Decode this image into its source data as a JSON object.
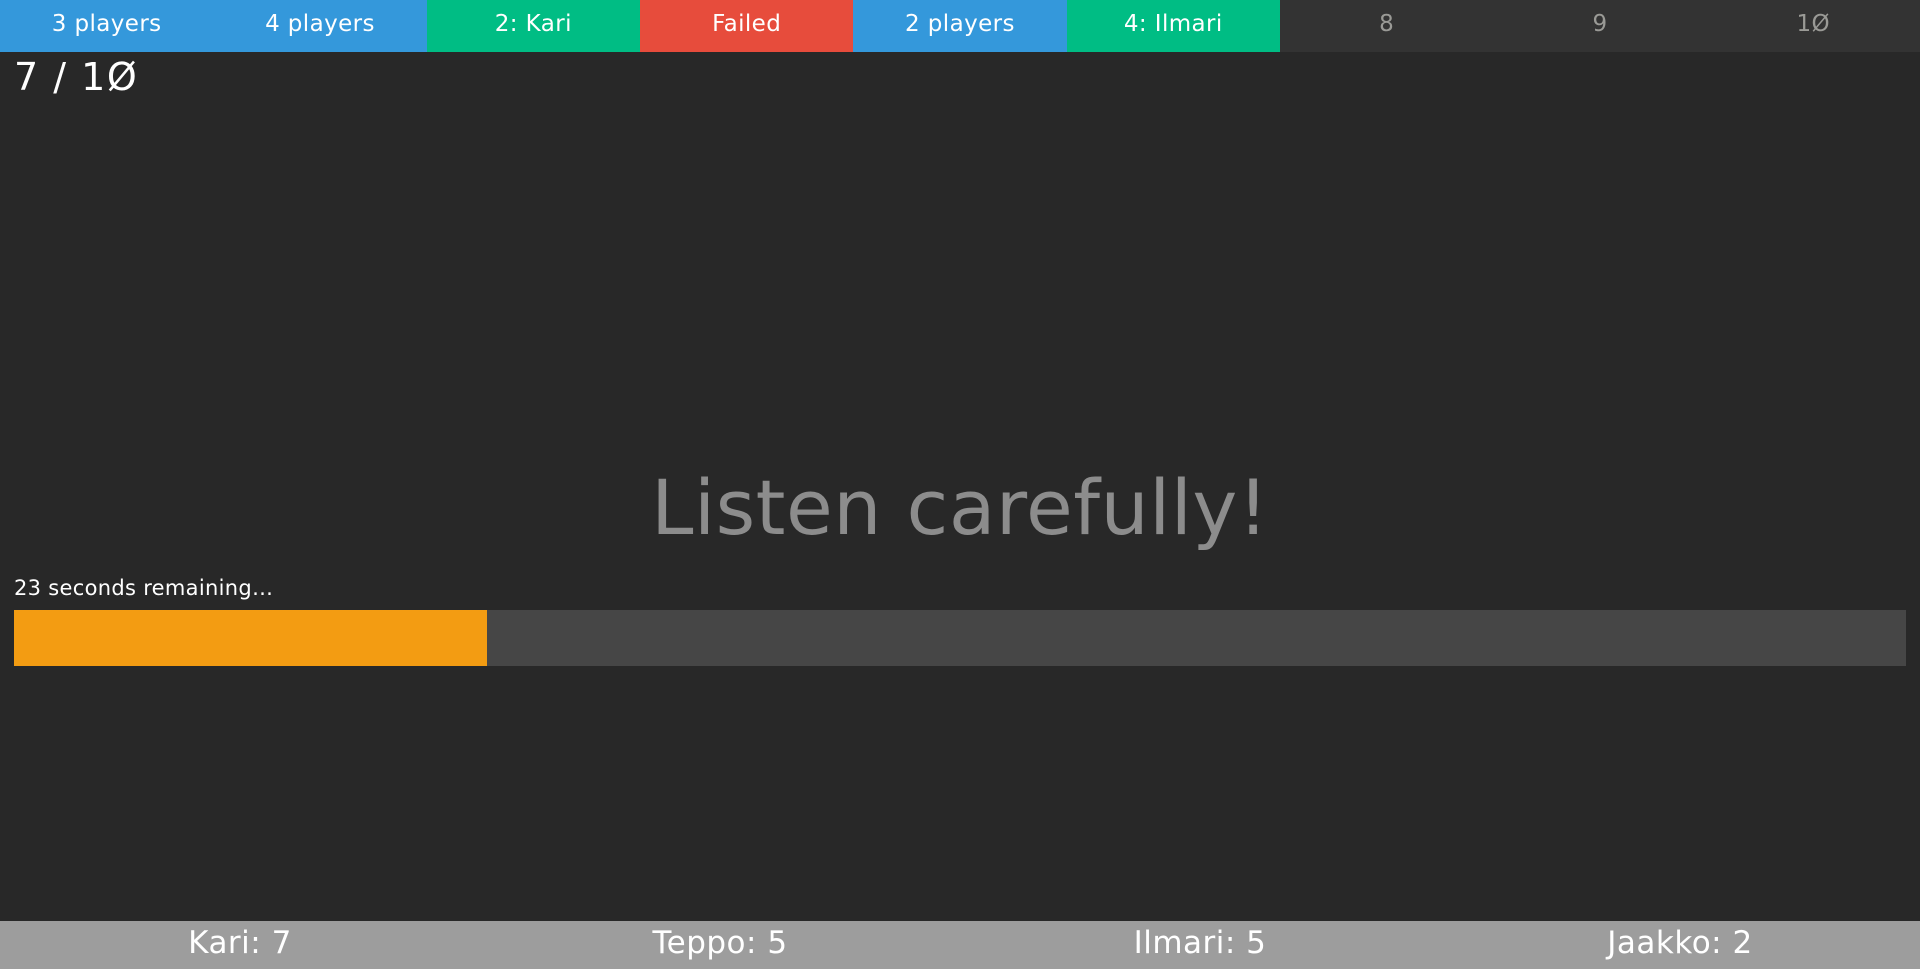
{
  "game": {
    "round_counter": "7 / 1Ø",
    "instruction": "Listen carefully!"
  },
  "round_strip": {
    "segments": [
      {
        "label": "3 players",
        "state": "players"
      },
      {
        "label": "4 players",
        "state": "players"
      },
      {
        "label": "2: Kari",
        "state": "success"
      },
      {
        "label": "Failed",
        "state": "failed"
      },
      {
        "label": "2 players",
        "state": "players"
      },
      {
        "label": "4: Ilmari",
        "state": "success"
      },
      {
        "label": "8",
        "state": "upcoming"
      },
      {
        "label": "9",
        "state": "upcoming"
      },
      {
        "label": "1Ø",
        "state": "upcoming"
      }
    ]
  },
  "timer": {
    "label": "23 seconds remaining…",
    "seconds_remaining": 23,
    "percent_remaining": 25,
    "fill_color": "#f39c12",
    "track_color": "#464646"
  },
  "scoreboard": {
    "players": [
      {
        "label": "Kari: 7"
      },
      {
        "label": "Teppo: 5"
      },
      {
        "label": "Ilmari: 5"
      },
      {
        "label": "Jaakko: 2"
      }
    ]
  },
  "theme": {
    "background": "#282828",
    "success": "#00bd84",
    "players": "#3498db",
    "failed": "#e74c3c",
    "upcoming": "#333333",
    "footer": "#9d9d9d",
    "heading": "#8c8c8c"
  }
}
